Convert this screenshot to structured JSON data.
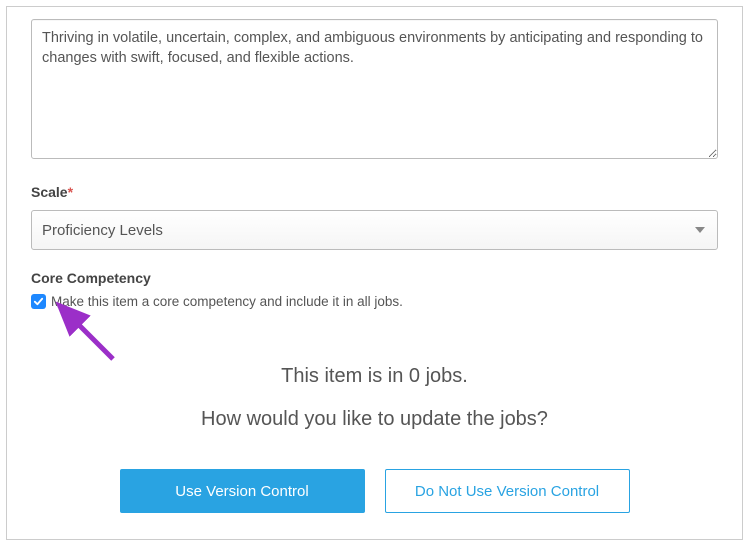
{
  "description": {
    "value": "Thriving in volatile, uncertain, complex, and ambiguous environments by anticipating and responding to changes with swift, focused, and flexible actions."
  },
  "scale": {
    "label": "Scale",
    "value": "Proficiency Levels"
  },
  "core": {
    "heading": "Core Competency",
    "checkbox_label": "Make this item a core competency and include it in all jobs.",
    "checked": true
  },
  "info": {
    "jobs_line": "This item is in 0 jobs.",
    "prompt": "How would you like to update the jobs?"
  },
  "buttons": {
    "use_vc": "Use Version Control",
    "no_vc": "Do Not Use Version Control"
  }
}
